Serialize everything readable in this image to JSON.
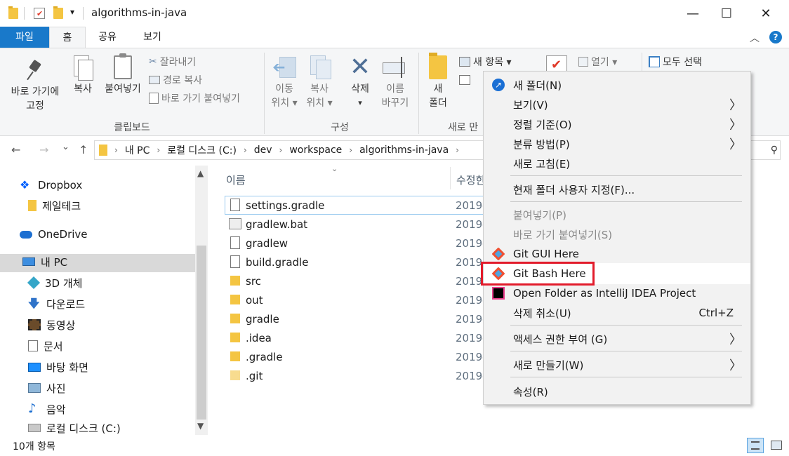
{
  "titlebar": {
    "title": "algorithms-in-java",
    "dropdown_glyph": "▾",
    "minimize": "—",
    "maximize": "☐",
    "close": "✕"
  },
  "tabs": {
    "file": "파일",
    "home": "홈",
    "share": "공유",
    "view": "보기"
  },
  "ribbon": {
    "pin_line1": "바로 가기에",
    "pin_line2": "고정",
    "copy": "복사",
    "paste": "붙여넣기",
    "cut": "잘라내기",
    "copy_path": "경로 복사",
    "paste_shortcut": "바로 가기 붙여넣기",
    "clipboard_group": "클립보드",
    "move_line1": "이동",
    "move_line2": "위치 ▾",
    "copyto_line1": "복사",
    "copyto_line2": "위치 ▾",
    "delete": "삭제",
    "delete_arrow": "▾",
    "rename_line1": "이름",
    "rename_line2": "바꾸기",
    "organize_group": "구성",
    "newfolder_line1": "새",
    "newfolder_line2": "폴더",
    "new_item": "새 항목 ▾",
    "new_group_partial": "새로 만",
    "open": "열기 ▾",
    "select_all": "모두 선택",
    "collapse_glyph": "︿",
    "help_glyph": "?"
  },
  "address": {
    "back": "←",
    "forward": "→",
    "recent": "⌄",
    "up": "↑",
    "crumbs": [
      "내 PC",
      "로컬 디스크 (C:)",
      "dev",
      "workspace",
      "algorithms-in-java"
    ],
    "crumb_sep": "›",
    "search_glyph": "⚲"
  },
  "nav": {
    "items": [
      "Dropbox",
      "제일테크",
      "OneDrive",
      "내 PC",
      "3D 개체",
      "다운로드",
      "동영상",
      "문서",
      "바탕 화면",
      "사진",
      "음악",
      "로컬 디스크 (C:)"
    ],
    "scroll_up": "▲",
    "scroll_down": "▼"
  },
  "files": {
    "col_name": "이름",
    "col_date": "수정한",
    "sort_glyph": "⌄",
    "rows": [
      {
        "name": "settings.gradle",
        "date": "2019-"
      },
      {
        "name": "gradlew.bat",
        "date": "2019-"
      },
      {
        "name": "gradlew",
        "date": "2019-"
      },
      {
        "name": "build.gradle",
        "date": "2019-"
      },
      {
        "name": "src",
        "date": "2019-"
      },
      {
        "name": "out",
        "date": "2019-"
      },
      {
        "name": "gradle",
        "date": "2019-"
      },
      {
        "name": ".idea",
        "date": "2019-"
      },
      {
        "name": ".gradle",
        "date": "2019-"
      },
      {
        "name": ".git",
        "date": "2019-"
      }
    ]
  },
  "status": {
    "count": "10개 항목"
  },
  "context_menu": {
    "new_folder": "새 폴더(N)",
    "view": "보기(V)",
    "sort_by": "정렬 기준(O)",
    "group_by": "분류 방법(P)",
    "refresh": "새로 고침(E)",
    "customize": "현재 폴더 사용자 지정(F)...",
    "paste": "붙여넣기(P)",
    "paste_shortcut": "바로 가기 붙여넣기(S)",
    "git_gui": "Git GUI Here",
    "git_bash": "Git Bash Here",
    "intellij": "Open Folder as IntelliJ IDEA Project",
    "undo_delete": "삭제 취소(U)",
    "undo_shortcut": "Ctrl+Z",
    "give_access": "액세스 권한 부여 (G)",
    "new": "새로 만들기(W)",
    "properties": "속성(R)",
    "submenu_arrow": "〉",
    "highlight_color": "#e21b2b"
  }
}
